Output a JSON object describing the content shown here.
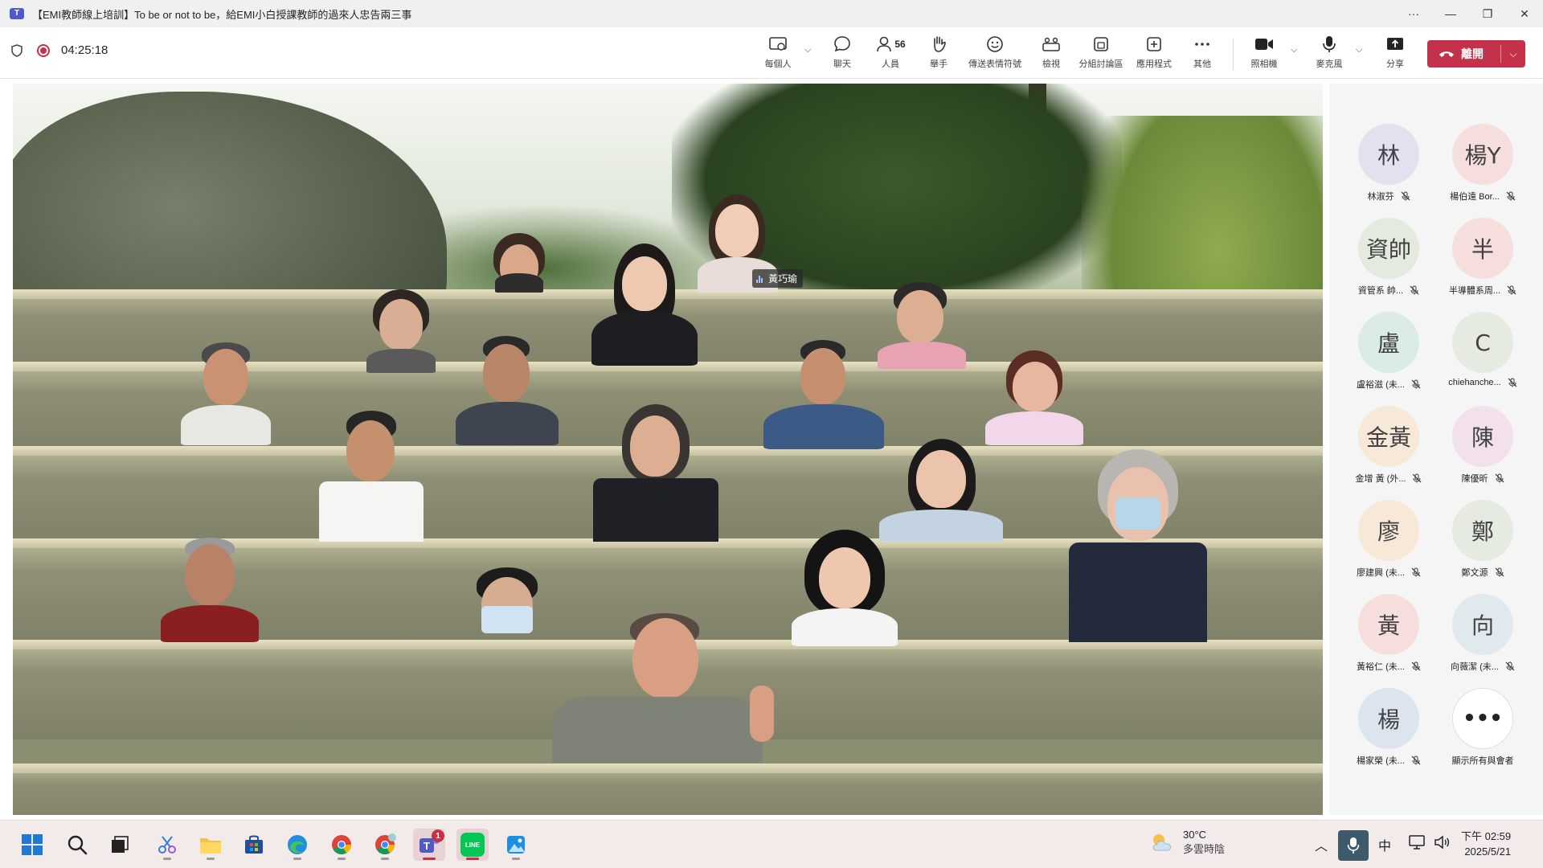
{
  "window": {
    "title": "【EMI教師線上培訓】To be or not to be，給EMI小白授課教師的過來人忠告兩三事",
    "logo_text": "T",
    "controls": [
      "···",
      "—",
      "❐",
      "✕"
    ]
  },
  "meeting_bar": {
    "timer": "04:25:18",
    "people_count": "56",
    "buttons": {
      "view_everyone": "每個人",
      "chat": "聊天",
      "people": "人員",
      "raise_hand": "舉手",
      "react": "傳送表情符號",
      "view": "檢視",
      "breakout_rooms": "分組討論區",
      "apps": "應用程式",
      "more": "其他",
      "camera": "照相機",
      "mic": "麥克風",
      "share": "分享"
    },
    "leave_label": "離開"
  },
  "stage": {
    "speaker_name_tag": "黃巧瑜"
  },
  "participants": [
    {
      "initials": "林",
      "name": "林淑芬",
      "color": "#e4e0f0"
    },
    {
      "initials": "楊Y",
      "name": "楊伯遠 Bor...",
      "color": "#f6dedd"
    },
    {
      "initials": "資帥",
      "name": "資管系 帥...",
      "color": "#e2ebde"
    },
    {
      "initials": "半",
      "name": "半導體系周...",
      "color": "#f6dedd"
    },
    {
      "initials": "盧",
      "name": "盧裕滋 (未...",
      "color": "#dbece4"
    },
    {
      "initials": "C",
      "name": "chiehanche...",
      "color": "#e6ebe1"
    },
    {
      "initials": "金黃",
      "name": "金增 黃 (外...",
      "color": "#f8e8d8"
    },
    {
      "initials": "陳",
      "name": "陳優昕",
      "color": "#f2e0ec"
    },
    {
      "initials": "廖",
      "name": "廖建興 (未...",
      "color": "#f8e8d8"
    },
    {
      "initials": "鄭",
      "name": "鄭文源",
      "color": "#e6ebe1"
    },
    {
      "initials": "黃",
      "name": "黃裕仁 (未...",
      "color": "#f6dedd"
    },
    {
      "initials": "向",
      "name": "向薇潔 (未...",
      "color": "#dfe9ee"
    },
    {
      "initials": "楊",
      "name": "楊家榮 (未...",
      "color": "#dce4f0"
    }
  ],
  "show_all": {
    "icon": "•••",
    "label": "顯示所有與會者"
  },
  "taskbar": {
    "teams_badge": "1",
    "line_label": "LINE",
    "weather_temp": "30°C",
    "weather_desc": "多雲時陰",
    "ime": "中",
    "time": "下午 02:59",
    "date": "2025/5/21"
  },
  "colors": {
    "leave_red": "#c4314b",
    "teams_purple": "#5059c9",
    "panel_bg": "#f5f5f5"
  }
}
